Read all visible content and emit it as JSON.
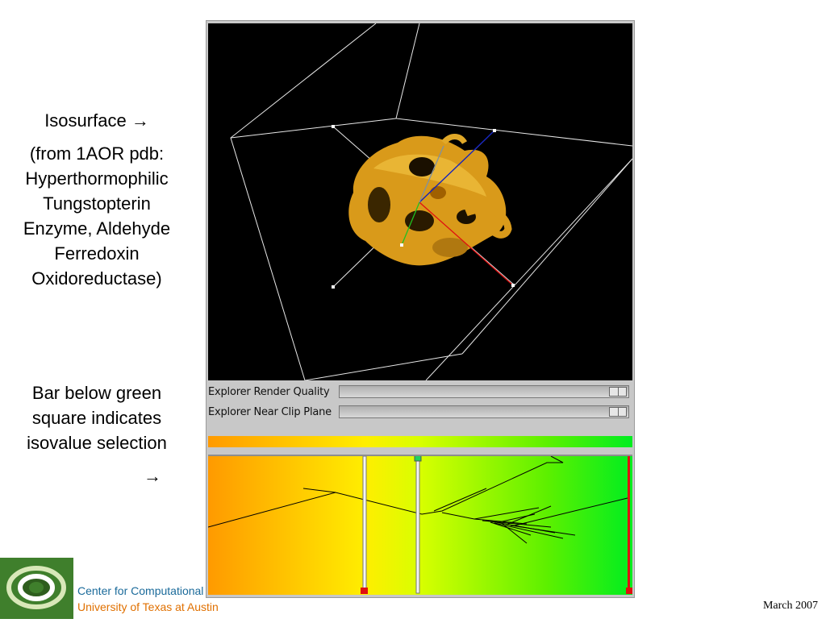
{
  "captions": {
    "isosurface_title": "Isosurface",
    "isosurface_arrow": "→",
    "isosurface_desc": "(from 1AOR pdb: Hyperthormophilic Tungstopterin Enzyme, Aldehyde Ferredoxin Oxidoreductase)",
    "bar_note": "Bar below green square indicates isovalue selection",
    "bar_arrow": "→"
  },
  "viewer": {
    "render_quality_label": "Explorer Render Quality",
    "near_clip_label": "Explorer Near Clip Plane",
    "render_quality_value": 1.0,
    "near_clip_value": 1.0,
    "isosurface_color": "#d99a1a",
    "axis_colors": {
      "x": "#e01010",
      "y": "#20c020",
      "z": "#1020c0"
    }
  },
  "contour_spectrum": {
    "gradient_colors": [
      "#ff9a00",
      "#ffee00",
      "#d8ff00",
      "#5cf000",
      "#00ee20"
    ],
    "isovalue_marker_color": "#20d060",
    "range_marker_color": "#e01010"
  },
  "footer": {
    "center": "Center for Computational Visualization",
    "university": "University of Texas at Austin",
    "date": "March 2007"
  }
}
